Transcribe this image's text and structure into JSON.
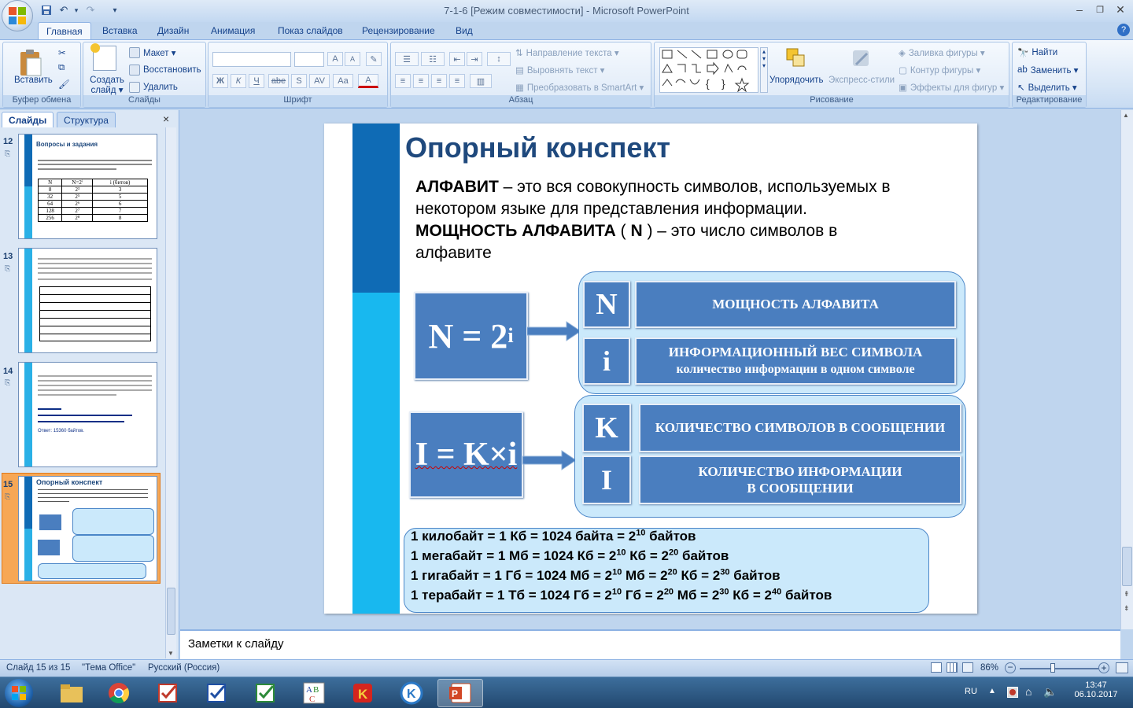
{
  "window": {
    "title": "7-1-6 [Режим совместимости] - Microsoft PowerPoint",
    "minimize": "–",
    "restore": "❐",
    "close": "✕"
  },
  "ribbon_tabs": [
    {
      "label": "Главная",
      "active": true
    },
    {
      "label": "Вставка"
    },
    {
      "label": "Дизайн"
    },
    {
      "label": "Анимация"
    },
    {
      "label": "Показ слайдов"
    },
    {
      "label": "Рецензирование"
    },
    {
      "label": "Вид"
    }
  ],
  "ribbon": {
    "clipboard": {
      "paste": "Вставить",
      "group": "Буфер обмена"
    },
    "slides": {
      "new_slide": "Создать слайд ▾",
      "layout": "Макет ▾",
      "reset": "Восстановить",
      "delete": "Удалить",
      "group": "Слайды"
    },
    "font": {
      "group": "Шрифт",
      "bold": "Ж",
      "italic": "К",
      "underline": "Ч",
      "strike": "abe",
      "shadow": "S",
      "spacing": "AV",
      "case": "Aa",
      "color": "A",
      "grow": "A",
      "shrink": "A"
    },
    "paragraph": {
      "text_direction": "Направление текста ▾",
      "align_text": "Выровнять текст ▾",
      "smartart": "Преобразовать в SmartArt ▾",
      "group": "Абзац"
    },
    "drawing": {
      "arrange": "Упорядочить",
      "quick_styles": "Экспресс-стили",
      "fill": "Заливка фигуры ▾",
      "outline": "Контур фигуры ▾",
      "effects": "Эффекты для фигур ▾",
      "group": "Рисование"
    },
    "editing": {
      "find": "Найти",
      "replace": "Заменить ▾",
      "select": "Выделить ▾",
      "group": "Редактирование"
    }
  },
  "panel": {
    "tab_slides": "Слайды",
    "tab_outline": "Структура",
    "close": "×"
  },
  "thumbnails": [
    {
      "num": "12",
      "title": "Вопросы и задания",
      "table_head": [
        "N",
        "N=2ⁱ",
        "i (битов)"
      ],
      "rows": [
        [
          "8",
          "2³",
          "3"
        ],
        [
          "32",
          "2⁵",
          "5"
        ],
        [
          "64",
          "2⁶",
          "6"
        ],
        [
          "128",
          "2⁷",
          "7"
        ],
        [
          "256",
          "2⁸",
          "8"
        ]
      ]
    },
    {
      "num": "13",
      "title": ""
    },
    {
      "num": "14",
      "title": "",
      "answer": "Ответ: 15360 байтов."
    },
    {
      "num": "15",
      "title": "Опорный конспект",
      "selected": true
    }
  ],
  "slide": {
    "title": "Опорный конспект",
    "def1_bold": "АЛФАВИТ",
    "def1_rest": " – это вся совокупность символов, используемых в",
    "def1_line2": "некотором языке  для  представления информации.",
    "def2_bold": "МОЩНОСТЬ  АЛФАВИТА",
    "def2_paren_open": "  (",
    "def2_n": " N ",
    "def2_rest": ") – это  число  символов в",
    "def2_line2": "алфавите",
    "formula1_base": "N = 2",
    "formula1_exp": "i",
    "box_N": "N",
    "box_N_text": "МОЩНОСТЬ  АЛФАВИТА",
    "box_i": "i",
    "box_i_text1": "ИНФОРМАЦИОННЫЙ  ВЕС СИМВОЛА",
    "box_i_text2": "количество  информации  в одном  символе",
    "formula2": "I = K×i",
    "box_K": "K",
    "box_K_text": "КОЛИЧЕСТВО   СИМВОЛОВ  В СООБЩЕНИИ",
    "box_I": "I",
    "box_I_text1": "КОЛИЧЕСТВО  ИНФОРМАЦИИ",
    "box_I_text2": "В СООБЩЕНИИ",
    "units": [
      {
        "a": "1 килобайт = 1 Кб = 1024 байта = 2",
        "e1": "10",
        "b": "  байтов",
        "e2": "",
        "c": "",
        "e3": "",
        "d": ""
      },
      {
        "a": "1 мегабайт = 1 Мб = 1024 Кб = 2",
        "e1": "10",
        "b": "  Кб = 2",
        "e2": "20",
        "c": " байтов",
        "e3": "",
        "d": ""
      },
      {
        "a": "1 гигабайт = 1 Гб = 1024 Мб = 2",
        "e1": "10",
        "b": " Мб = 2",
        "e2": "20",
        "c": " Кб = 2",
        "e3": "30",
        "d": " байтов"
      },
      {
        "a": "1 терабайт = 1 Тб = 1024 Гб = 2",
        "e1": "10",
        "b": " Гб = 2",
        "e2": "20",
        "c": " Мб = 2",
        "e3": "30",
        "d": " Кб = 2"
      }
    ],
    "unit4_tail_exp": "40",
    "unit4_tail": " байтов"
  },
  "notes": {
    "placeholder": "Заметки к слайду"
  },
  "status": {
    "slide": "Слайд 15 из 15",
    "theme": "\"Тема Office\"",
    "lang": "Русский (Россия)",
    "zoom": "86%",
    "zoom_level": 0.86
  },
  "taskbar": {
    "lang": "RU",
    "time": "13:47",
    "date": "06.10.2017"
  }
}
